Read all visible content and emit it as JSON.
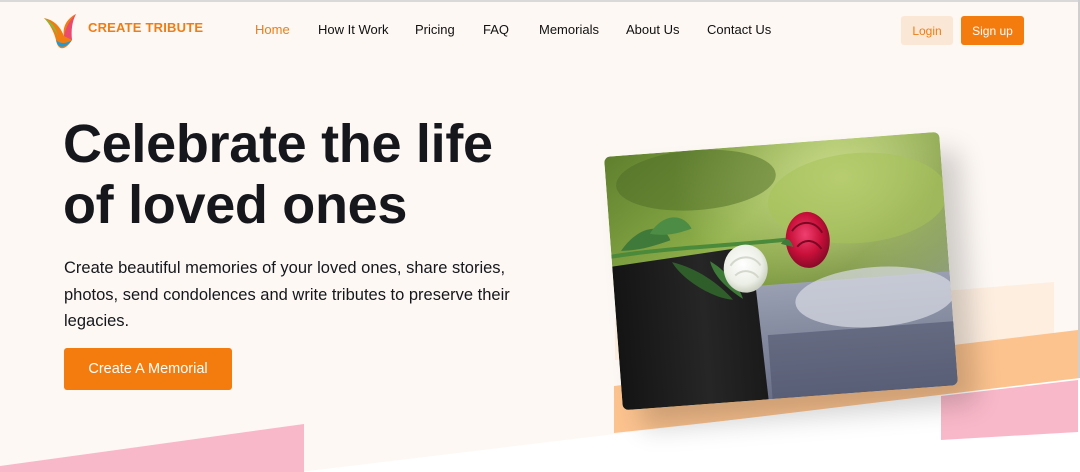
{
  "brand": {
    "name": "CREATE TRIBUTE",
    "accent": "#f47b0e",
    "logo_icon": "bird-logo-icon"
  },
  "nav": {
    "items": [
      {
        "label": "Home",
        "active": true
      },
      {
        "label": "How It Work",
        "active": false
      },
      {
        "label": "Pricing",
        "active": false
      },
      {
        "label": "FAQ",
        "active": false
      },
      {
        "label": "Memorials",
        "active": false
      },
      {
        "label": "About Us",
        "active": false
      },
      {
        "label": "Contact Us",
        "active": false
      }
    ]
  },
  "auth": {
    "login_label": "Login",
    "signup_label": "Sign up"
  },
  "hero": {
    "title_line1": "Celebrate the life",
    "title_line2": "of loved ones",
    "subtitle": "Create beautiful memories of your loved ones, share stories, photos, send condolences and write tributes to preserve their legacies.",
    "cta_label": "Create A Memorial",
    "image_description_icon": "roses-photo"
  },
  "colors": {
    "background": "#fdf8f4",
    "accent": "#f47b0e",
    "login_bg": "#fbe7d6",
    "pink_shape": "#f9b8c9",
    "peach_shape": "#fcc38f"
  }
}
